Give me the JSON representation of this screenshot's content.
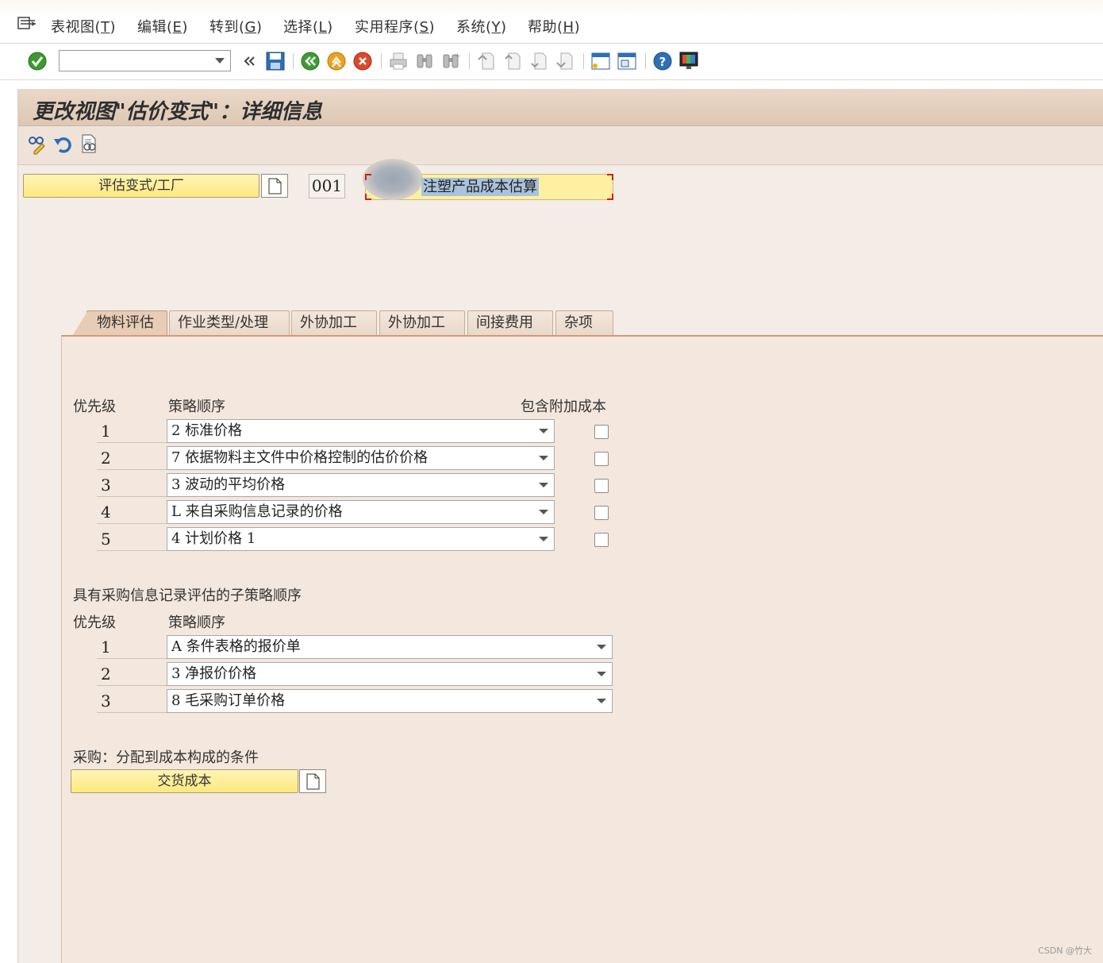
{
  "menu": [
    {
      "label": "表视图(",
      "key": "T"
    },
    {
      "label": "编辑(",
      "key": "E"
    },
    {
      "label": "转到(",
      "key": "G"
    },
    {
      "label": "选择(",
      "key": "L"
    },
    {
      "label": "实用程序(",
      "key": "S"
    },
    {
      "label": "系统(",
      "key": "Y"
    },
    {
      "label": "帮助(",
      "key": "H"
    }
  ],
  "toolbar": {
    "command_field": "",
    "icons": [
      "enter-icon",
      "back-arrows-icon",
      "save-icon",
      "back-icon",
      "exit-icon",
      "cancel-icon",
      "print-icon",
      "find-icon",
      "find-next-icon",
      "first-page-icon",
      "previous-page-icon",
      "next-page-icon",
      "last-page-icon",
      "create-session-icon",
      "shortcut-icon",
      "help-icon",
      "customize-layout-icon"
    ]
  },
  "page_title": "更改视图\"估价变式\"：详细信息",
  "header": {
    "valuation_button": "评估变式/工厂",
    "code": "001",
    "description": "注塑产品成本估算"
  },
  "tabs": [
    "物料评估",
    "作业类型/处理",
    "外协加工",
    "外协加工",
    "间接费用",
    "杂项"
  ],
  "active_tab": 0,
  "strategy": {
    "col_priority": "优先级",
    "col_sequence": "策略顺序",
    "col_overhead": "包含附加成本",
    "rows": [
      {
        "priority": "1",
        "value": "2 标准价格",
        "overhead": false
      },
      {
        "priority": "2",
        "value": "7 依据物料主文件中价格控制的估价价格",
        "overhead": false
      },
      {
        "priority": "3",
        "value": "3 波动的平均价格",
        "overhead": false
      },
      {
        "priority": "4",
        "value": "L 来自采购信息记录的价格",
        "overhead": false
      },
      {
        "priority": "5",
        "value": "4 计划价格 1",
        "overhead": false
      }
    ]
  },
  "sub_strategy": {
    "section_title": "具有采购信息记录评估的子策略顺序",
    "col_priority": "优先级",
    "col_sequence": "策略顺序",
    "rows": [
      {
        "priority": "1",
        "value": "A 条件表格的报价单"
      },
      {
        "priority": "2",
        "value": "3 净报价价格"
      },
      {
        "priority": "3",
        "value": "8 毛采购订单价格"
      }
    ]
  },
  "purchasing": {
    "section_title": "采购：分配到成本构成的条件",
    "button": "交货成本"
  },
  "watermark": "CSDN @竹大"
}
